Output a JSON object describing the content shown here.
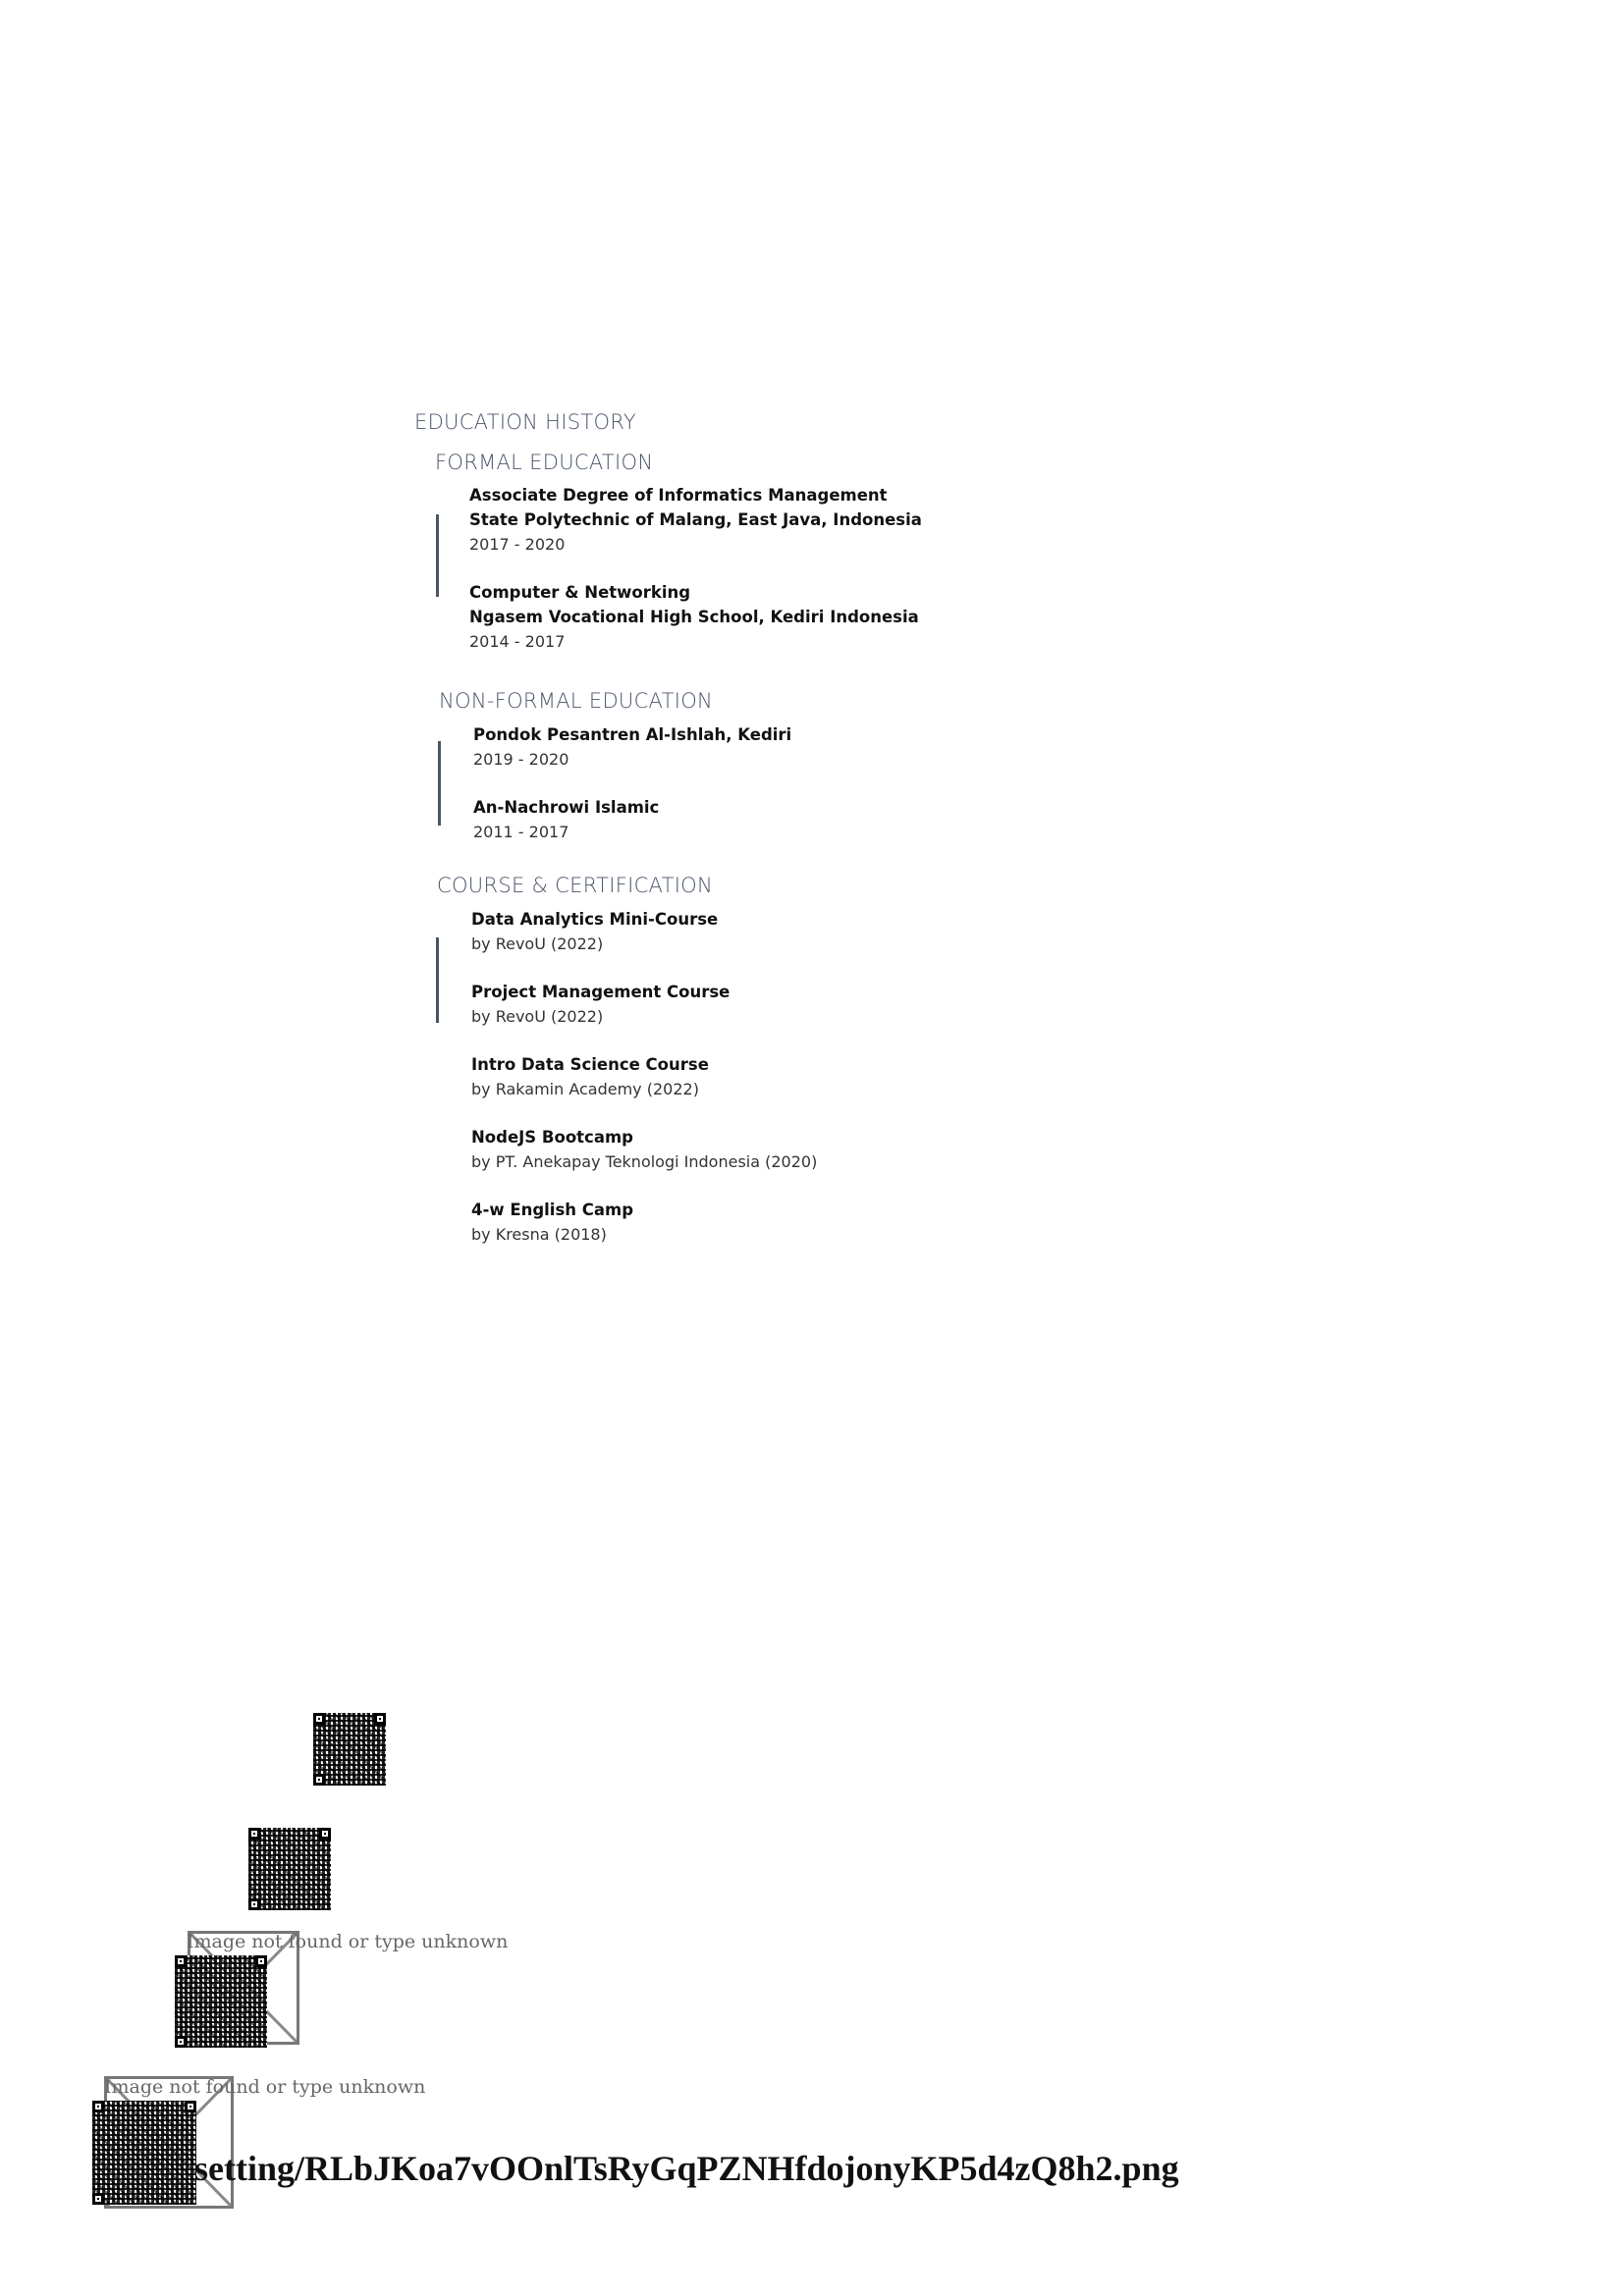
{
  "education": {
    "title": "EDUCATION HISTORY",
    "formal": {
      "title": "FORMAL EDUCATION",
      "entries": [
        {
          "degree": "Associate Degree of Informatics Management",
          "school": "State Polytechnic of Malang, East Java, Indonesia",
          "years": "2017 - 2020"
        },
        {
          "degree": "Computer & Networking",
          "school": "Ngasem Vocational High School, Kediri Indonesia",
          "years": "2014 - 2017"
        }
      ]
    },
    "non_formal": {
      "title": "NON-FORMAL EDUCATION",
      "entries": [
        {
          "name": "Pondok Pesantren Al-Ishlah, Kediri",
          "years": "2019 - 2020"
        },
        {
          "name": "An-Nachrowi Islamic",
          "years": "2011 - 2017"
        }
      ]
    },
    "courses": {
      "title": "COURSE & CERTIFICATION",
      "entries": [
        {
          "name": "Data Analytics Mini-Course",
          "provider": "by RevoU (2022)"
        },
        {
          "name": "Project Management Course",
          "provider": "by RevoU (2022)"
        },
        {
          "name": "Intro Data Science Course",
          "provider": "by Rakamin Academy (2022)"
        },
        {
          "name": "NodeJS Bootcamp",
          "provider": "by PT. Anekapay Teknologi Indonesia (2020)"
        },
        {
          "name": "4-w English Camp",
          "provider": "by Kresna (2018)"
        }
      ]
    }
  },
  "broken_images": [
    {
      "alt": "Image not found or type unknown"
    },
    {
      "alt": "Image not found or type unknown"
    }
  ],
  "footer_path": "setting/RLbJKoa7vOOnlTsRyGqPZNHfdojonyKP5d4zQ8h2.png",
  "colors": {
    "heading": "#4a5568",
    "accent_bar": "#4a5568",
    "text": "#111111"
  }
}
